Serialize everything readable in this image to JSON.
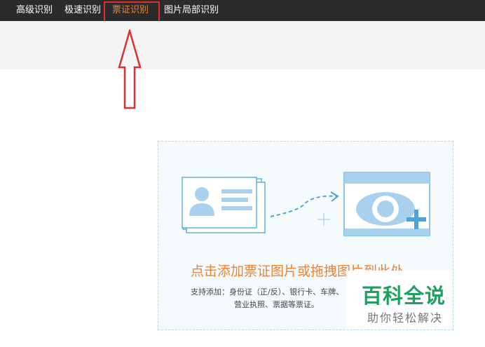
{
  "tabs": [
    {
      "label": "高级识别",
      "active": false
    },
    {
      "label": "极速识别",
      "active": false
    },
    {
      "label": "票证识别",
      "active": true
    },
    {
      "label": "图片局部识别",
      "active": false
    }
  ],
  "upload": {
    "title": "点击添加票证图片或拖拽图片到此处",
    "desc_line1": "支持添加：身份证（正/反）、银行卡、车牌、",
    "desc_line2": "营业执照、票据等票证。"
  },
  "watermark": {
    "title": "百科全说",
    "subtitle": "助你轻松解决"
  },
  "colors": {
    "topbar": "#2b2b2b",
    "active_tab": "#f0812f",
    "annotation_red": "#e12d2d",
    "icon_blue": "#4ba3d8",
    "watermark_green": "#1ea160"
  },
  "icons": [
    "id-card-icon",
    "dashed-arrow-icon",
    "move-cursor-icon",
    "image-eye-icon",
    "plus-icon"
  ]
}
